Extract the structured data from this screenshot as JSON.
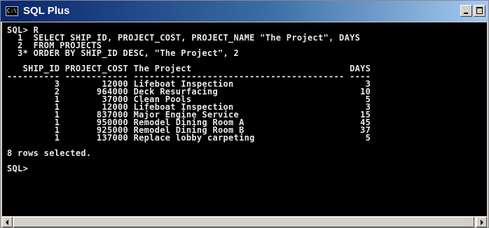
{
  "window": {
    "title": "SQL Plus",
    "icon": "console-icon",
    "icon_glyph": "C:\\",
    "buttons": [
      "minimize-icon",
      "maximize-icon"
    ]
  },
  "console": {
    "lines": [
      "SQL> R",
      "  1  SELECT SHIP_ID, PROJECT_COST, PROJECT_NAME \"The Project\", DAYS",
      "  2  FROM PROJECTS",
      "  3* ORDER BY SHIP_ID DESC, \"The Project\", 2",
      "",
      "   SHIP_ID PROJECT_COST The Project                              DAYS",
      "---------- ------------ ---------------------------------------- ----",
      "         3        12000 Lifeboat Inspection                         3",
      "         2       964000 Deck Resurfacing                           10",
      "         1        37000 Clean Pools                                 5",
      "         1        12000 Lifeboat Inspection                         3",
      "         1       837000 Major Engine Service                       15",
      "         1       950000 Remodel Dining Room A                      45",
      "         1       925000 Remodel Dining Room B                      37",
      "         1       137000 Replace lobby carpeting                     5",
      "",
      "8 rows selected.",
      "",
      "SQL>"
    ]
  },
  "colors": {
    "console_bg": "#000000",
    "console_fg": "#e8e8e8",
    "titlebar_start": "#0a246a",
    "titlebar_end": "#a6caf0"
  }
}
